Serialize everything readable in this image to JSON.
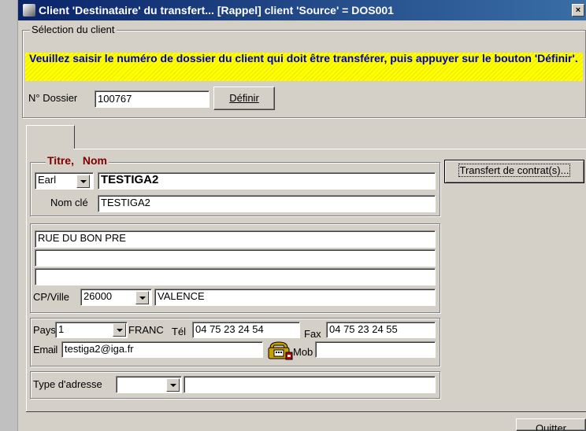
{
  "window": {
    "title": "Client 'Destinataire' du transfert... [Rappel] client 'Source' = DOS001",
    "close_glyph": "×"
  },
  "selection": {
    "group_label": "Sélection du client",
    "prompt": "Veuillez saisir le numéro de dossier du client qui doit être transférer, puis appuyer sur le bouton 'Définir'.",
    "dossier_label": "N° Dossier",
    "dossier_value": "100767",
    "definir_label": "Définir"
  },
  "identity": {
    "titre_label": "Titre,",
    "nom_label": "Nom",
    "titre_value": "Earl",
    "nom_value": "TESTIGA2",
    "nomcle_label": "Nom clé",
    "nomcle_value": "TESTIGA2"
  },
  "transfert_button": "Transfert de contrat(s)...",
  "address": {
    "line1": "RUE DU BON PRE",
    "line2": "",
    "line3": "",
    "cpville_label": "CP/Ville",
    "cp_value": "26000",
    "ville_value": "VALENCE"
  },
  "contact": {
    "pays_label": "Pays",
    "pays_value": "1",
    "pays_name": "FRANC",
    "tel_label": "Tél",
    "tel_value": "04 75 23 24 54",
    "fax_label": "Fax",
    "fax_value": "04 75 23 24 55",
    "email_label": "Email",
    "email_value": "testiga2@iga.fr",
    "mob_label": "Mob",
    "mob_value": ""
  },
  "type_adresse": {
    "label": "Type d'adresse",
    "value": "",
    "extra": ""
  },
  "quitter_label": "Quitter"
}
